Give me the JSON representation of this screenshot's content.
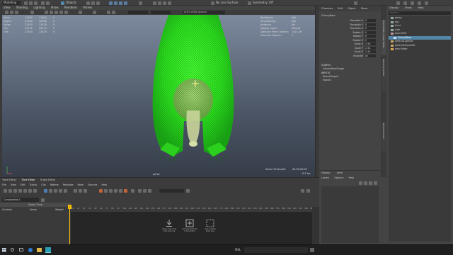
{
  "top_menu": {
    "workspace": "Modeling",
    "menus": [
      "File",
      "Edit",
      "Create",
      "Select",
      "Modify",
      "Display",
      "Windows",
      "Mesh",
      "Edit Mesh",
      "Mesh Tools",
      "Mesh Display",
      "Curves",
      "Surfaces",
      "Deform",
      "UV",
      "Generate",
      "Cache",
      "Arnold",
      "Help"
    ],
    "objects_label": "Objects",
    "live_surface": "No Live Surface",
    "symmetry": "Symmetry: Off"
  },
  "viewport": {
    "menus": [
      "View",
      "Shading",
      "Lighting",
      "Show",
      "Renderer",
      "Panels"
    ],
    "color_space": "ACES sRGB gamma",
    "hud_left": [
      {
        "label": "Verts:",
        "a": "21600",
        "b": "21600",
        "c": "0"
      },
      {
        "label": "Edges:",
        "a": "43180",
        "b": "43180",
        "c": "0"
      },
      {
        "label": "Faces:",
        "a": "21579",
        "b": "21579",
        "c": "0"
      },
      {
        "label": "Tris:",
        "a": "43172",
        "b": "43172",
        "c": "0"
      },
      {
        "label": "UVs:",
        "a": "22430",
        "b": "22430",
        "c": "0"
      }
    ],
    "hud_right": [
      {
        "label": "Backfaces:",
        "value": "N/A"
      },
      {
        "label": "Smoothness:",
        "value": "N/A"
      },
      {
        "label": "Instance:",
        "value": "No"
      },
      {
        "label": "Display Layer:",
        "value": "default"
      },
      {
        "label": "Distance From Camera:",
        "value": "1421.36"
      },
      {
        "label": "Selected Objects:",
        "value": "1"
      }
    ],
    "camera": "persp",
    "timecode_label": "Scene Timecode:",
    "timecode": "00:00:00:00",
    "fps": "6.3 fps"
  },
  "channel_box": {
    "tabs": [
      "Channels",
      "Edit",
      "Object",
      "Show"
    ],
    "object": "GrizzlyBear",
    "channels": [
      {
        "name": "Translate X",
        "value": "0"
      },
      {
        "name": "Translate Y",
        "value": "0"
      },
      {
        "name": "Translate Z",
        "value": "0"
      },
      {
        "name": "Rotate X",
        "value": "0"
      },
      {
        "name": "Rotate Y",
        "value": "0"
      },
      {
        "name": "Rotate Z",
        "value": "0"
      },
      {
        "name": "Scale X",
        "value": "2.54"
      },
      {
        "name": "Scale Y",
        "value": "2.54"
      },
      {
        "name": "Scale Z",
        "value": "2.54"
      },
      {
        "name": "Visibility",
        "value": "on"
      }
    ],
    "shapes_header": "SHAPES",
    "shape": "GrizzlyBearShape",
    "inputs_header": "INPUTS",
    "inputs": [
      "blendShape4",
      "tweak1"
    ]
  },
  "layer_editor": {
    "tabs": [
      "Display",
      "Anim"
    ],
    "menus": [
      "Layers",
      "Options",
      "Help"
    ]
  },
  "outliner": {
    "menus": [
      "Display",
      "Show",
      "Help"
    ],
    "search_placeholder": "Search...",
    "items": [
      {
        "label": "persp"
      },
      {
        "label": "top"
      },
      {
        "label": "front"
      },
      {
        "label": "side"
      },
      {
        "label": "bearsFBX"
      },
      {
        "label": "GrizzlyBear"
      },
      {
        "label": "defaultLightSet"
      },
      {
        "label": "defaultObjectSet"
      },
      {
        "label": "bearEditor"
      }
    ],
    "selected_index": 5
  },
  "side_tabs": [
    "Channel Box / Layer Editor",
    "Modeling Toolkit",
    "Attribute Editor"
  ],
  "time_editor": {
    "tabs": [
      "Trace Editor",
      "Time Editor",
      "Graph Editor"
    ],
    "menus": [
      "File",
      "View",
      "Edit",
      "Tracks",
      "Clip",
      "Retime",
      "Relocate",
      "Bake",
      "Sources",
      "Help"
    ],
    "composition": "Composition1",
    "header": "Scene Time",
    "columns": [
      "Controls",
      "Name",
      "Weight"
    ],
    "ruler": [
      "10",
      "20",
      "30",
      "40",
      "50",
      "60",
      "70",
      "80",
      "90",
      "100",
      "110",
      "120",
      "130",
      "140",
      "150",
      "160",
      "170",
      "180",
      "190",
      "200",
      "210",
      "220",
      "230",
      "240",
      "250",
      "260",
      "270",
      "280",
      "290",
      "300",
      "310",
      "320",
      "330",
      "340",
      "350",
      "360",
      "370",
      "380",
      "390",
      "400",
      "410",
      "420",
      "430"
    ],
    "playhead": "1",
    "empty_hints": [
      "Create Audio Track / Add Audio Clip",
      "Add Selected Nodes to Time Editor",
      "Drag and Drop Items Here"
    ]
  },
  "taskbar": {
    "mel": "MEL"
  }
}
